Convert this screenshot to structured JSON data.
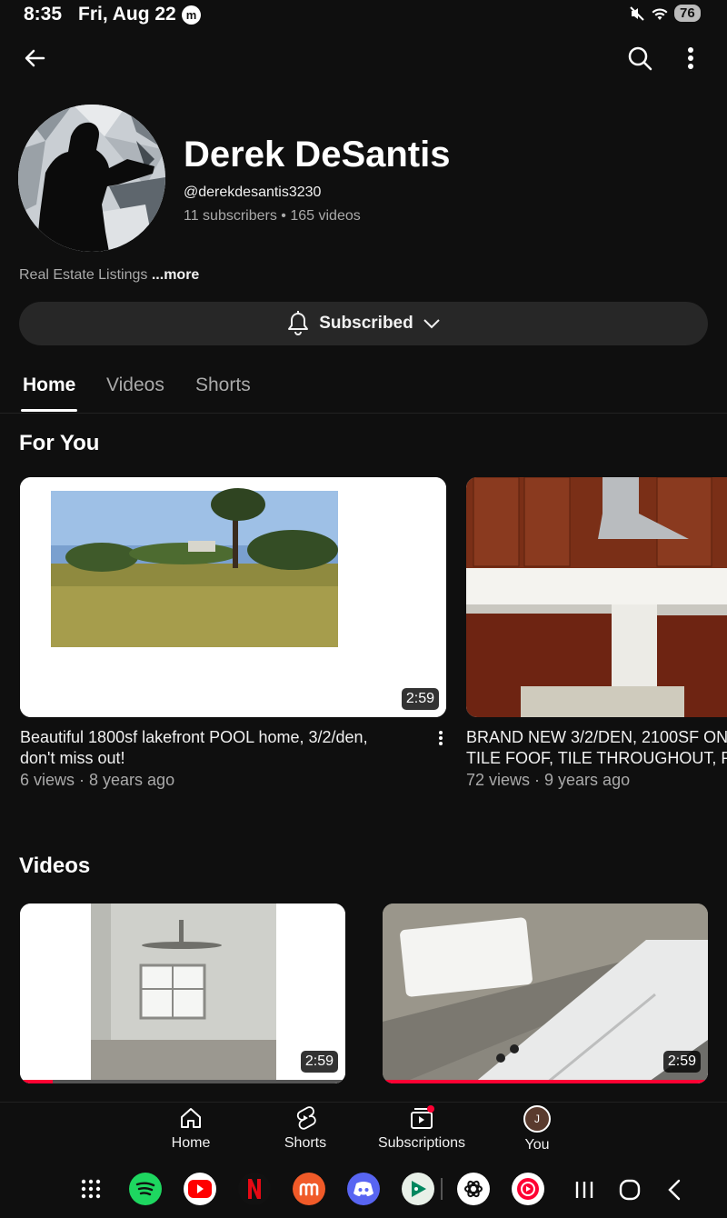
{
  "status_bar": {
    "time": "8:35",
    "date": "Fri, Aug 22",
    "battery": "76"
  },
  "top_bar": {
    "back_icon": "arrow-left-icon",
    "search_icon": "search-icon",
    "more_icon": "more-vert-icon"
  },
  "channel": {
    "name": "Derek DeSantis",
    "handle": "@derekdesantis3230",
    "stats": "11 subscribers • 165 videos",
    "description": "Real Estate Listings ",
    "more_label": "...more",
    "subscribe_label": "Subscribed"
  },
  "tabs": [
    {
      "label": "Home"
    },
    {
      "label": "Videos"
    },
    {
      "label": "Shorts"
    }
  ],
  "for_you": {
    "title": "For You",
    "videos": [
      {
        "title_line1": "Beautiful 1800sf lakefront POOL home, 3/2/den,",
        "title_line2": "don't miss out!",
        "meta": "6 views · 8 years ago",
        "duration": "2:59"
      },
      {
        "title_line1": "BRAND NEW 3/2/DEN, 2100SF ON",
        "title_line2": "TILE FOOF, TILE THROUGHOUT, PA",
        "meta": "72 views · 9 years ago"
      }
    ]
  },
  "videos_section": {
    "title": "Videos",
    "videos": [
      {
        "duration": "2:59",
        "progress": 0.1
      },
      {
        "duration": "2:59",
        "progress": 1.0
      }
    ]
  },
  "bottom_nav": [
    {
      "label": "Home",
      "icon": "home-icon"
    },
    {
      "label": "Shorts",
      "icon": "shorts-icon"
    },
    {
      "label": "Subscriptions",
      "icon": "subscriptions-icon"
    },
    {
      "label": "You",
      "icon": "avatar-icon",
      "initial": "J"
    }
  ],
  "dock": {
    "apps": [
      "app-drawer-icon",
      "spotify-icon",
      "youtube-icon",
      "netflix-icon",
      "moonpay-icon",
      "discord-icon",
      "play-games-icon",
      "chatgpt-icon",
      "youtube-music-icon"
    ],
    "nav": [
      "recents-icon",
      "home-button-icon",
      "back-icon"
    ]
  },
  "colors": {
    "background": "#0f0f0f",
    "surface": "#272727",
    "progress_red": "#ff0033",
    "secondary_text": "#aaaaaa"
  }
}
